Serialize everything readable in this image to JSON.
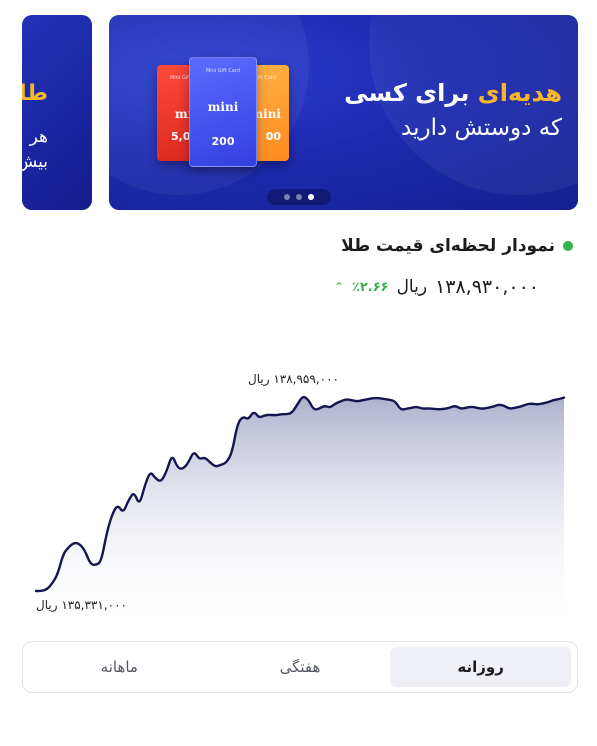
{
  "banners": {
    "side": {
      "title": "طلا",
      "line1": "هر",
      "line2": "بیش"
    },
    "main": {
      "title_highlight": "هدیه‌ای",
      "title_rest": " برای کسی",
      "subtitle": "که دوستش دارید",
      "cards": [
        {
          "brand": "mini",
          "amount": "5,0",
          "color": "#e8302a"
        },
        {
          "brand": "mini",
          "amount": "200",
          "color": "#4150f0"
        },
        {
          "brand": "mini",
          "amount": "00",
          "color": "#ff9a2a"
        }
      ],
      "carousel": {
        "count": 3,
        "active_index": 2
      }
    }
  },
  "chart_header": {
    "title": "نمودار لحظه‌ای قیمت طلا",
    "price": "۱۳۸,۹۳۰,۰۰۰",
    "unit": "ریال",
    "change": "٪۲.۶۶",
    "trend_icon": "chevron-up-icon"
  },
  "chart_data": {
    "type": "area",
    "title": "نمودار لحظه‌ای قیمت طلا",
    "max_label": "۱۳۸,۹۵۹,۰۰۰ ریال",
    "min_label": "۱۳۵,۳۳۱,۰۰۰ ریال",
    "ymin": 135331000,
    "ymax": 138959000,
    "line_color": "#13164f",
    "fill_color": "#b9bcd4",
    "values": [
      135331000,
      135331000,
      135360000,
      135470000,
      135650000,
      136020000,
      136150000,
      136230000,
      136210000,
      136080000,
      135830000,
      135810000,
      135880000,
      136420000,
      136760000,
      136940000,
      136780000,
      137020000,
      137180000,
      136920000,
      137300000,
      137560000,
      137420000,
      137360000,
      137560000,
      137880000,
      137620000,
      137600000,
      137720000,
      137940000,
      137780000,
      137820000,
      137720000,
      137640000,
      137680000,
      137720000,
      137900000,
      138440000,
      138580000,
      138520000,
      138680000,
      138550000,
      138600000,
      138610000,
      138600000,
      138620000,
      138620000,
      138640000,
      138800000,
      138959000,
      138900000,
      138700000,
      138720000,
      138780000,
      138740000,
      138820000,
      138860000,
      138900000,
      138880000,
      138860000,
      138880000,
      138900000,
      138920000,
      138920000,
      138900000,
      138890000,
      138860000,
      138700000,
      138720000,
      138740000,
      138760000,
      138720000,
      138730000,
      138720000,
      138710000,
      138720000,
      138740000,
      138780000,
      138720000,
      138740000,
      138760000,
      138740000,
      138720000,
      138740000,
      138760000,
      138800000,
      138780000,
      138720000,
      138740000,
      138760000,
      138800000,
      138820000,
      138800000,
      138820000,
      138840000,
      138880000,
      138900000,
      138930000
    ]
  },
  "tabs": [
    {
      "label": "روزانه",
      "active": true
    },
    {
      "label": "هفتگی",
      "active": false
    },
    {
      "label": "ماهانه",
      "active": false
    }
  ]
}
